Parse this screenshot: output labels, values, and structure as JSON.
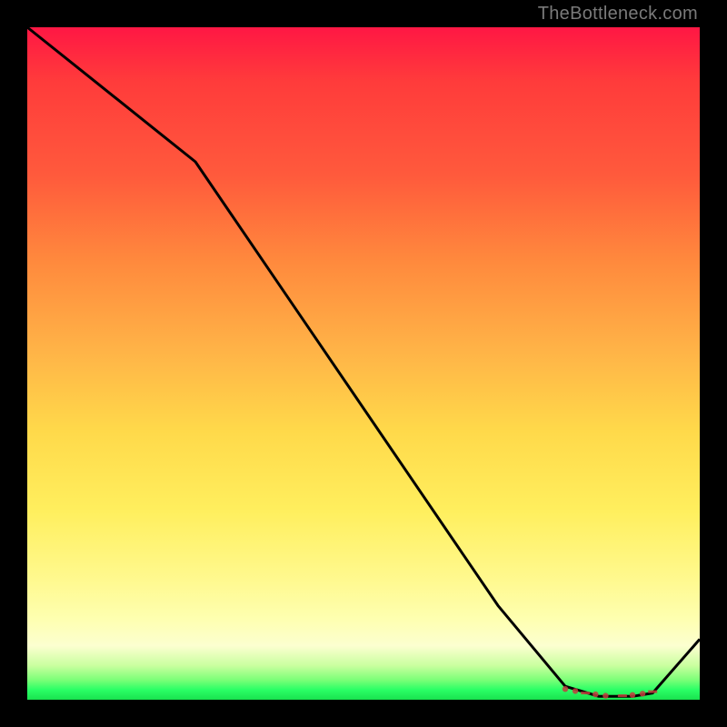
{
  "watermark": "TheBottleneck.com",
  "chart_data": {
    "type": "line",
    "title": "",
    "xlabel": "",
    "ylabel": "",
    "xlim": [
      0,
      100
    ],
    "ylim": [
      0,
      100
    ],
    "grid": false,
    "legend": false,
    "x": [
      0,
      10,
      20,
      25,
      40,
      55,
      70,
      80,
      85,
      90,
      93,
      100
    ],
    "values": [
      100,
      92,
      84,
      80,
      58,
      36,
      14,
      2,
      0.5,
      0.5,
      1,
      9
    ],
    "note": "y read as percentage of plot height from bottom; x as percentage of plot width from left; line descends steeply then flattens near 0 around x≈80–92 then rises slightly",
    "feature_points_x": [
      80,
      81.5,
      83,
      84.5,
      86,
      88.5,
      90,
      91.5,
      93
    ],
    "feature_points_y": [
      1.6,
      1.3,
      1.0,
      0.8,
      0.6,
      0.6,
      0.7,
      0.9,
      1.2
    ]
  },
  "colors": {
    "background": "#000000",
    "line": "#000000",
    "feature": "#c23e3e"
  }
}
